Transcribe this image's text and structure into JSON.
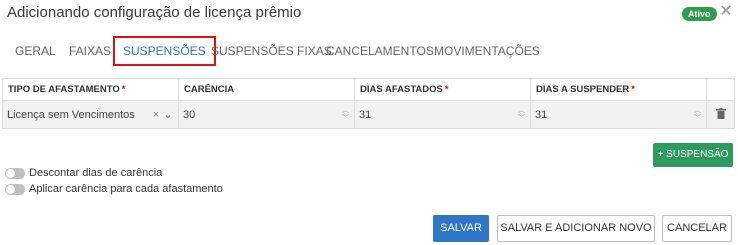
{
  "dialog": {
    "title": "Adicionando configuração de licença prêmio",
    "status_badge": "Ativo",
    "close_glyph": "✕"
  },
  "tabs": [
    {
      "label": "GERAL"
    },
    {
      "label": "FAIXAS"
    },
    {
      "label": "SUSPENSÕES",
      "active": true
    },
    {
      "label": "SUSPENSÕES FIXAS"
    },
    {
      "label": "CANCELAMENTOS"
    },
    {
      "label": "MOVIMENTAÇÕES"
    }
  ],
  "table": {
    "headers": [
      {
        "label": "TIPO DE AFASTAMENTO",
        "required": "*"
      },
      {
        "label": "CARÊNCIA",
        "required": ""
      },
      {
        "label": "DIAS AFASTADOS",
        "required": "*"
      },
      {
        "label": "DIAS A SUSPENDER",
        "required": "*"
      }
    ],
    "row": {
      "tipo_afastamento": "Licença sem Vencimentos",
      "carencia": "30",
      "dias_afastados": "31",
      "dias_suspender": "31"
    }
  },
  "add_button": "+ SUSPENSÃO",
  "toggles": [
    {
      "label": "Descontar dias de carência",
      "on": false
    },
    {
      "label": "Aplicar carência para cada afastamento",
      "on": false
    }
  ],
  "footer": {
    "save": "SALVAR",
    "save_new": "SALVAR E ADICIONAR NOVO",
    "cancel": "CANCELAR"
  },
  "colors": {
    "primary": "#2f76c9",
    "success": "#2f9a5f",
    "badge": "#2e9e4e",
    "required": "#d0021b",
    "highlight_border": "#e01010"
  },
  "icons": {
    "close": "close-icon",
    "clear": "clear-icon",
    "chevron": "chevron-down-icon",
    "spinner": "spinner-icon",
    "delete": "trash-icon"
  }
}
